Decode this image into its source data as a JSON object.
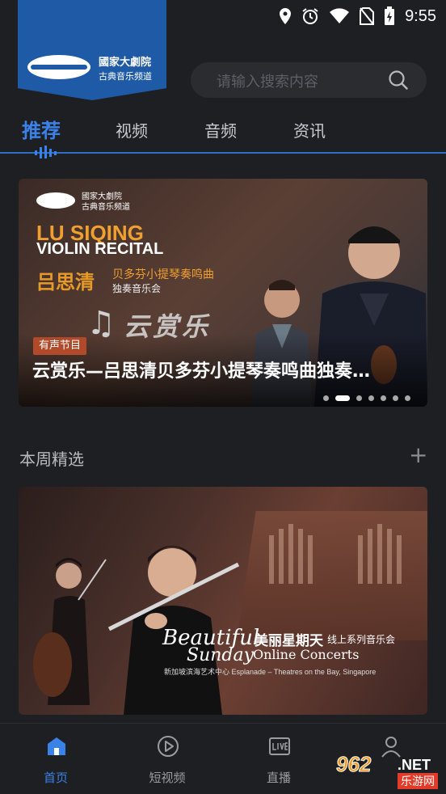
{
  "status_bar": {
    "time": "9:55",
    "icons": [
      "location-icon",
      "alarm-icon",
      "wifi-icon",
      "no-sim-icon",
      "battery-charging-icon"
    ]
  },
  "header": {
    "logo_line1": "國家大劇院",
    "logo_line2": "古典音乐频道"
  },
  "search": {
    "placeholder": "请输入搜索内容"
  },
  "tabs": [
    {
      "label": "推荐",
      "active": true
    },
    {
      "label": "视频",
      "active": false
    },
    {
      "label": "音频",
      "active": false
    },
    {
      "label": "资讯",
      "active": false
    }
  ],
  "banner": {
    "logo_line1": "國家大劇院",
    "logo_line2": "古典音乐频道",
    "en_line1": "LU SIQING",
    "en_line2": "VIOLIN RECITAL",
    "cn_name": "吕思清",
    "cn_sub1": "贝多芬小提琴奏鸣曲",
    "cn_sub2": "独奏音乐会",
    "art_text": "云赏乐",
    "badge": "有声节目",
    "title": "云赏乐—吕思清贝多芬小提琴奏鸣曲独奏…",
    "page_count": 7,
    "active_page": 2
  },
  "section": {
    "title": "本周精选",
    "action": "+"
  },
  "card": {
    "en_line1": "Beautiful",
    "en_line2": "Sunday",
    "cn_line1": "美丽星期天",
    "cn_line2": "线上系列音乐会",
    "en_line3": "Online Concerts",
    "small": "新加坡滨海艺术中心 Esplanade – Theatres on the Bay, Singapore"
  },
  "bottom_nav": [
    {
      "label": "首页",
      "icon": "home-icon",
      "active": true
    },
    {
      "label": "短视频",
      "icon": "play-circle-icon",
      "active": false
    },
    {
      "label": "直播",
      "icon": "live-icon",
      "active": false
    },
    {
      "label": "",
      "icon": "profile-icon",
      "active": false
    }
  ],
  "watermark": {
    "number": "962",
    "suffix": ".NET",
    "site": "乐游网"
  },
  "colors": {
    "accent": "#3b82e8",
    "background": "#1e1f22",
    "logo_blue": "#1f5aa6",
    "badge": "#b04a2a"
  }
}
